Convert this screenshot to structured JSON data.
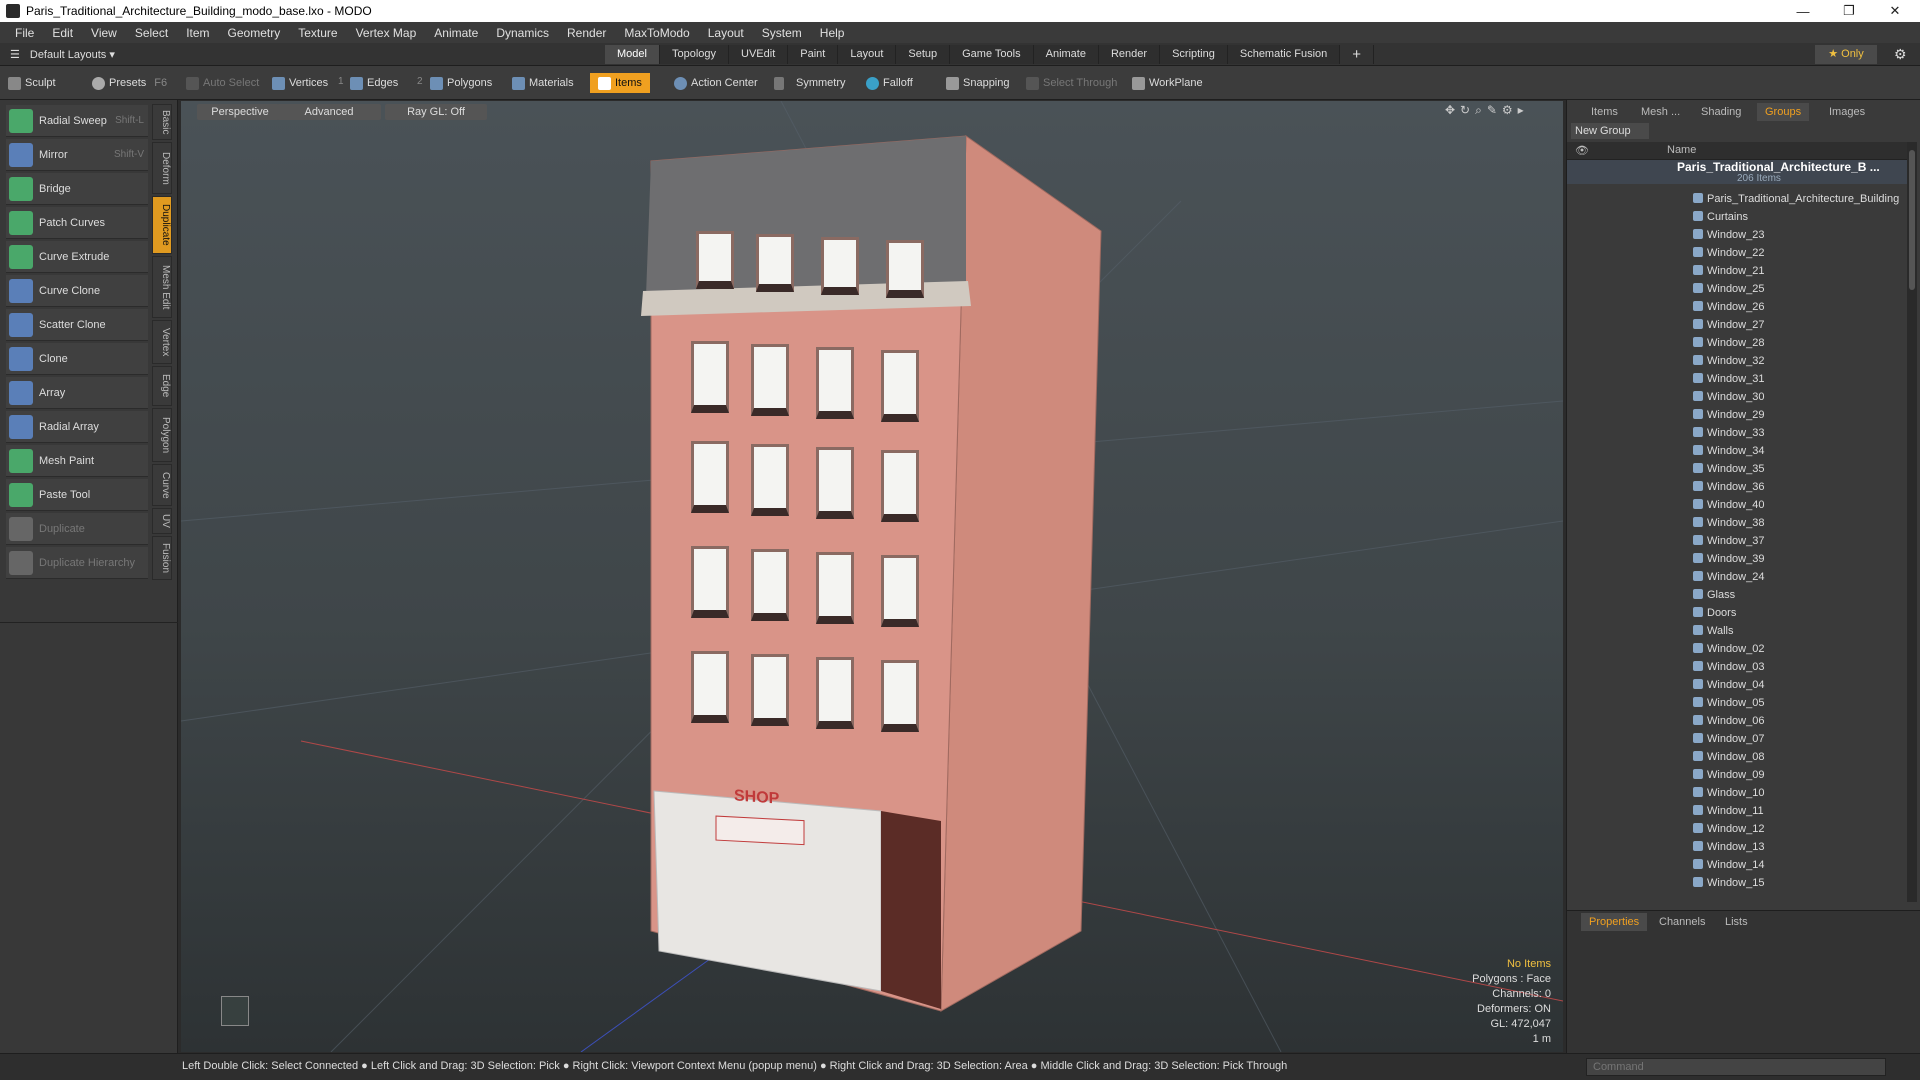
{
  "window": {
    "title": "Paris_Traditional_Architecture_Building_modo_base.lxo - MODO",
    "min": "—",
    "max": "❐",
    "close": "✕"
  },
  "menu": [
    "File",
    "Edit",
    "View",
    "Select",
    "Item",
    "Geometry",
    "Texture",
    "Vertex Map",
    "Animate",
    "Dynamics",
    "Render",
    "MaxToModo",
    "Layout",
    "System",
    "Help"
  ],
  "layout_select": "Default Layouts ▾",
  "tabs": [
    "Model",
    "Topology",
    "UVEdit",
    "Paint",
    "Layout",
    "Setup",
    "Game Tools",
    "Animate",
    "Render",
    "Scripting",
    "Schematic Fusion"
  ],
  "active_tab": "Model",
  "only_label": "★ Only",
  "toolbar": {
    "sculpt": "Sculpt",
    "presets": "Presets",
    "presets_key": "F6",
    "auto_select": "Auto Select",
    "vertices": "Vertices",
    "vertices_n": "1",
    "edges": "Edges",
    "edges_n": "2",
    "polygons": "Polygons",
    "materials": "Materials",
    "items": "Items",
    "action_center": "Action Center",
    "symmetry": "Symmetry",
    "falloff": "Falloff",
    "snapping": "Snapping",
    "select_through": "Select Through",
    "workplane": "WorkPlane"
  },
  "tools": [
    {
      "label": "Radial Sweep",
      "key": "Shift-L",
      "color": "#4aa86a"
    },
    {
      "label": "Mirror",
      "key": "Shift-V",
      "color": "#5a7fb8"
    },
    {
      "label": "Bridge",
      "key": "",
      "color": "#4aa86a"
    },
    {
      "label": "Patch Curves",
      "key": "",
      "color": "#4aa86a"
    },
    {
      "label": "Curve Extrude",
      "key": "",
      "color": "#4aa86a"
    },
    {
      "label": "Curve Clone",
      "key": "",
      "color": "#5a7fb8"
    },
    {
      "label": "Scatter Clone",
      "key": "",
      "color": "#5a7fb8"
    },
    {
      "label": "Clone",
      "key": "",
      "color": "#5a7fb8"
    },
    {
      "label": "Array",
      "key": "",
      "color": "#5a7fb8"
    },
    {
      "label": "Radial Array",
      "key": "",
      "color": "#5a7fb8"
    },
    {
      "label": "Mesh Paint",
      "key": "",
      "color": "#4aa86a"
    },
    {
      "label": "Paste Tool",
      "key": "",
      "color": "#4aa86a"
    },
    {
      "label": "Duplicate",
      "key": "",
      "color": "#666666"
    },
    {
      "label": "Duplicate Hierarchy",
      "key": "",
      "color": "#666666"
    }
  ],
  "vtabs": [
    "Basic",
    "Deform",
    "Duplicate",
    "Mesh Edit",
    "Vertex",
    "Edge",
    "Polygon",
    "Curve",
    "UV",
    "Fusion"
  ],
  "active_vtab": "Duplicate",
  "viewport": {
    "perspective": "Perspective",
    "advanced": "Advanced",
    "raygl": "Ray GL: Off",
    "shop_sign": "SHOP",
    "info": {
      "no_items": "No Items",
      "polygons": "Polygons : Face",
      "channels": "Channels: 0",
      "deformers": "Deformers: ON",
      "gl": "GL: 472,047",
      "scale": "1 m"
    }
  },
  "right_tabs": [
    "Items",
    "Mesh ...",
    "Shading",
    "Groups",
    "Images"
  ],
  "active_right_tab": "Groups",
  "groups": {
    "new_group": "New Group",
    "name_header": "Name",
    "root": "Paris_Traditional_Architecture_B ...",
    "root_count": "206 Items",
    "items": [
      "Paris_Traditional_Architecture_Building",
      "Curtains",
      "Window_23",
      "Window_22",
      "Window_21",
      "Window_25",
      "Window_26",
      "Window_27",
      "Window_28",
      "Window_32",
      "Window_31",
      "Window_30",
      "Window_29",
      "Window_33",
      "Window_34",
      "Window_35",
      "Window_36",
      "Window_40",
      "Window_38",
      "Window_37",
      "Window_39",
      "Window_24",
      "Glass",
      "Doors",
      "Walls",
      "Window_02",
      "Window_03",
      "Window_04",
      "Window_05",
      "Window_06",
      "Window_07",
      "Window_08",
      "Window_09",
      "Window_10",
      "Window_11",
      "Window_12",
      "Window_13",
      "Window_14",
      "Window_15"
    ]
  },
  "prop_tabs": [
    "Properties",
    "Channels",
    "Lists"
  ],
  "active_prop_tab": "Properties",
  "status": "Left Double Click: Select Connected ● Left Click and Drag: 3D Selection: Pick ● Right Click: Viewport Context Menu (popup menu) ● Right Click and Drag: 3D Selection: Area ● Middle Click and Drag: 3D Selection: Pick Through",
  "command_placeholder": "Command"
}
